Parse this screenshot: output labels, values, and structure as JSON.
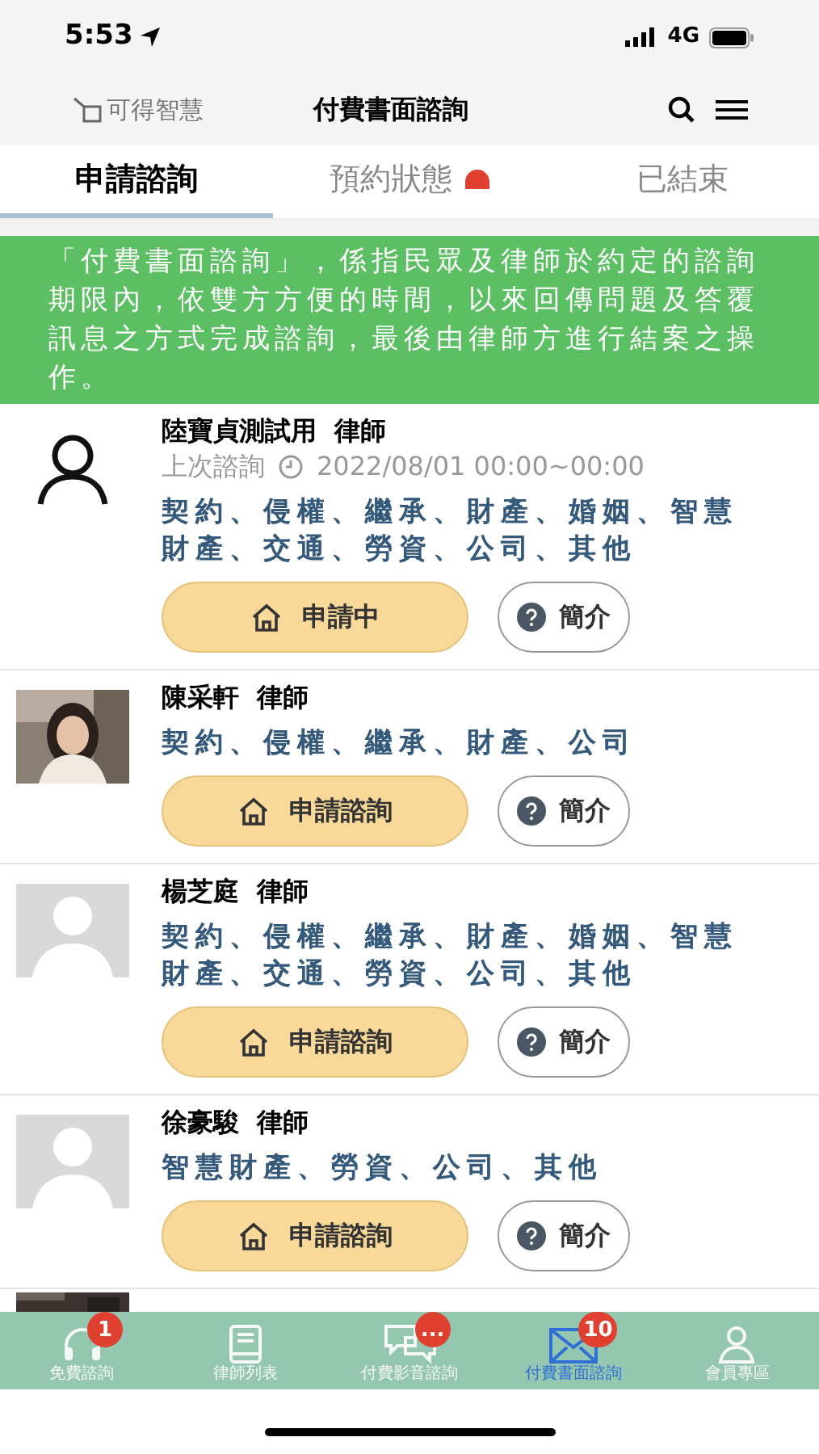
{
  "status_bar": {
    "time": "5:53",
    "network": "4G"
  },
  "header": {
    "logo_text": "可得智慧",
    "title": "付費書面諮詢"
  },
  "tabs": [
    {
      "label": "申請諮詢",
      "selected": true,
      "badge": false
    },
    {
      "label": "預約狀態",
      "selected": false,
      "badge": true
    },
    {
      "label": "已結束",
      "selected": false,
      "badge": false
    }
  ],
  "notice": "「付費書面諮詢」，係指民眾及律師於約定的諮詢期限內，依雙方方便的時間，以來回傳問題及答覆訊息之方式完成諮詢，最後由律師方進行結案之操作。",
  "lawyers": [
    {
      "kind": "outline",
      "name": "陸寶貞測試用  律師",
      "last_label": "上次諮詢",
      "last_time": "2022/08/01 00:00~00:00",
      "areas": "契約、侵權、繼承、財產、婚姻、智慧財產、交通、勞資、公司、其他",
      "apply": "申請中",
      "intro": "簡介"
    },
    {
      "kind": "picture",
      "name": "陳采軒  律師",
      "areas": "契約、侵權、繼承、財產、公司",
      "apply": "申請諮詢",
      "intro": "簡介"
    },
    {
      "kind": "placeholder",
      "name": "楊芝庭  律師",
      "areas": "契約、侵權、繼承、財產、婚姻、智慧財產、交通、勞資、公司、其他",
      "apply": "申請諮詢",
      "intro": "簡介"
    },
    {
      "kind": "placeholder",
      "name": "徐豪駿  律師",
      "areas": "智慧財產、勞資、公司、其他",
      "apply": "申請諮詢",
      "intro": "簡介"
    }
  ],
  "bottom_nav": [
    {
      "kind": "headset",
      "label": "免費諮詢",
      "badge": "1",
      "selected": false
    },
    {
      "kind": "book",
      "label": "律師列表",
      "selected": false
    },
    {
      "kind": "chat",
      "label": "付費影音諮詢",
      "badge": "...",
      "selected": false
    },
    {
      "kind": "mail",
      "label": "付費書面諮詢",
      "badge": "10",
      "selected": true
    },
    {
      "kind": "user",
      "label": "會員專區",
      "selected": false
    }
  ]
}
